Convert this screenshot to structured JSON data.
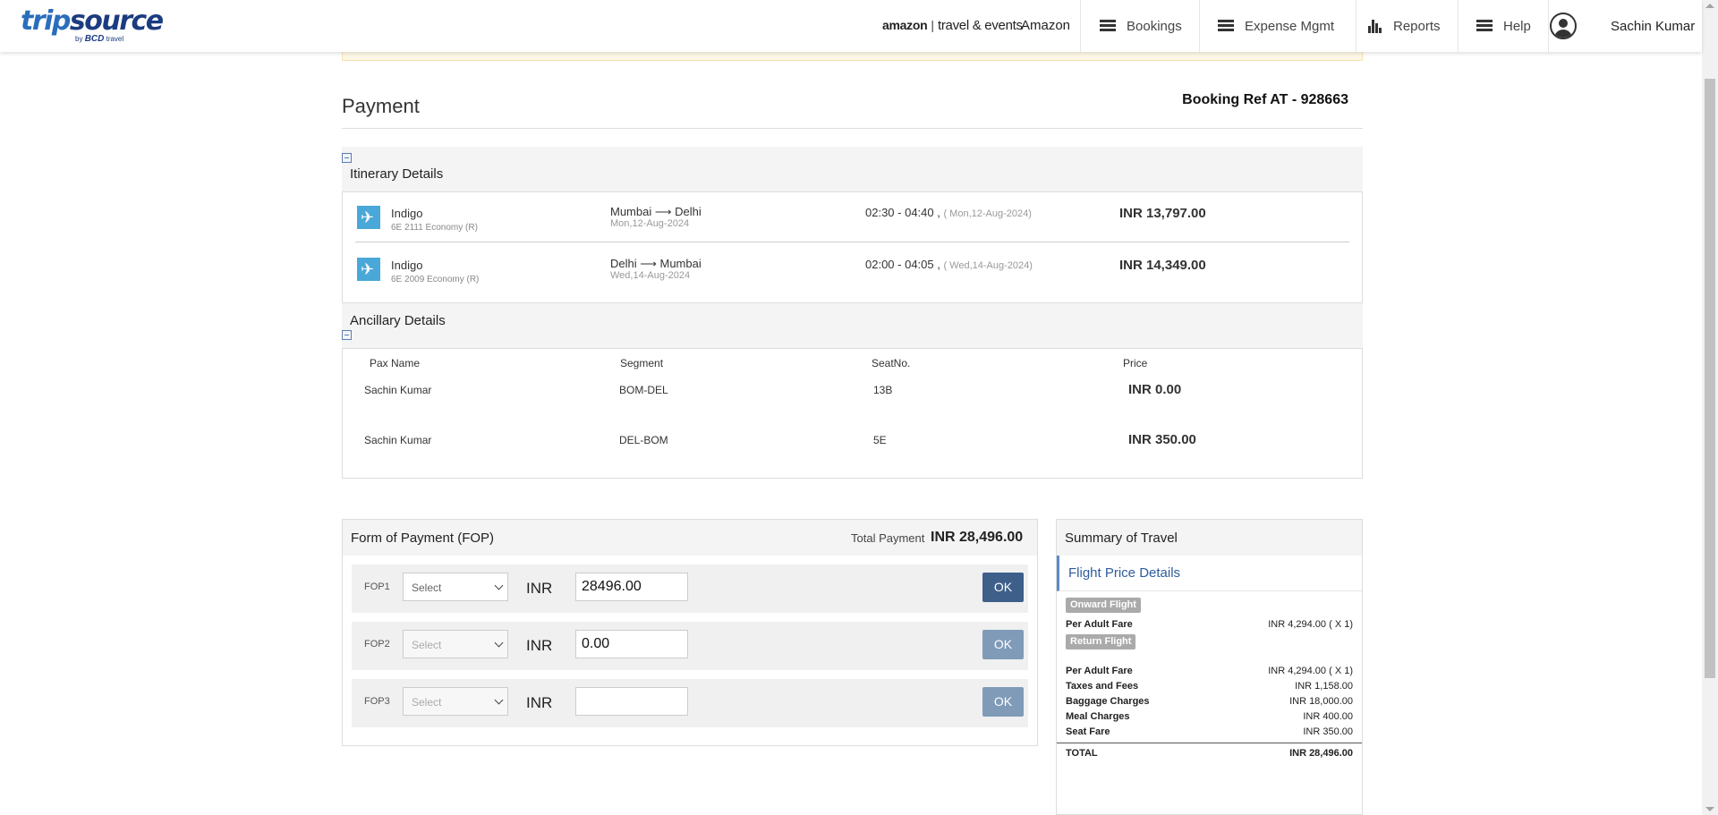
{
  "header": {
    "logo_main_a": "trip",
    "logo_main_b": "source",
    "logo_by": "by",
    "logo_bcd": "BCD",
    "logo_travel": "travel",
    "brand_amazon": "amazon",
    "brand_te": "travel & events",
    "brand_name": "Amazon",
    "nav": [
      {
        "label": "Bookings",
        "icon": "menu-icon"
      },
      {
        "label": "Expense Mgmt",
        "icon": "menu-icon"
      },
      {
        "label": "Reports",
        "icon": "bar-chart-icon"
      },
      {
        "label": "Help",
        "icon": "menu-icon"
      }
    ],
    "user_name": "Sachin Kumar"
  },
  "page": {
    "title": "Payment",
    "booking_ref": "Booking Ref AT - 928663"
  },
  "itinerary": {
    "title": "Itinerary Details",
    "flights": [
      {
        "airline": "Indigo",
        "flight": "6E 2111 Economy (R)",
        "route": "Mumbai ⟶ Delhi",
        "date": "Mon,12-Aug-2024",
        "time": "02:30 - 04:40 , ",
        "time_date": "( Mon,12-Aug-2024)",
        "price": "INR 13,797.00"
      },
      {
        "airline": "Indigo",
        "flight": "6E 2009 Economy (R)",
        "route": "Delhi ⟶ Mumbai",
        "date": "Wed,14-Aug-2024",
        "time": "02:00 - 04:05 , ",
        "time_date": "( Wed,14-Aug-2024)",
        "price": "INR 14,349.00"
      }
    ]
  },
  "ancillary": {
    "title": "Ancillary Details",
    "headers": [
      "Pax Name",
      "Segment",
      "SeatNo.",
      "Price"
    ],
    "rows": [
      {
        "pax": "Sachin Kumar",
        "segment": "BOM-DEL",
        "seat": "13B",
        "price": "INR 0.00"
      },
      {
        "pax": "Sachin Kumar",
        "segment": "DEL-BOM",
        "seat": "5E",
        "price": "INR 350.00"
      }
    ]
  },
  "fop": {
    "title": "Form of Payment (FOP)",
    "total_label": "Total Payment",
    "total_value": "INR 28,496.00",
    "rows": [
      {
        "label": "FOP1",
        "select": "Select",
        "currency": "INR",
        "amount": "28496.00",
        "ok": "OK"
      },
      {
        "label": "FOP2",
        "select": "Select",
        "currency": "INR",
        "amount": "0.00",
        "ok": "OK"
      },
      {
        "label": "FOP3",
        "select": "Select",
        "currency": "INR",
        "amount": "",
        "ok": "OK"
      }
    ]
  },
  "summary": {
    "title": "Summary of Travel",
    "subtitle": "Flight Price Details",
    "onward_tag": "Onward Flight",
    "return_tag": "Return Flight",
    "onward_rows": [
      {
        "label": "Per Adult Fare",
        "value": "INR 4,294.00 ( X 1)"
      }
    ],
    "return_rows": [
      {
        "label": "Per Adult Fare",
        "value": "INR 4,294.00 ( X 1)"
      },
      {
        "label": "Taxes and Fees",
        "value": "INR 1,158.00"
      },
      {
        "label": "Baggage Charges",
        "value": "INR 18,000.00"
      },
      {
        "label": "Meal Charges",
        "value": "INR 400.00"
      },
      {
        "label": "Seat Fare",
        "value": "INR 350.00"
      }
    ],
    "total_label": "TOTAL",
    "total_value": "INR 28,496.00"
  },
  "colors": {
    "ok_active": "#3d5f8a",
    "ok_disabled": "#7f9bb8",
    "accent_blue": "#2f5c9c"
  }
}
